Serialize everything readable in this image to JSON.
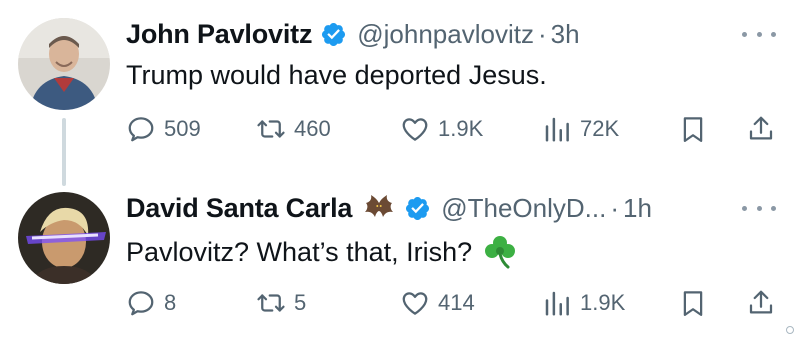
{
  "tweets": [
    {
      "name": "John Pavlovitz",
      "handle": "@johnpavlovitz",
      "separator": "·",
      "time": "3h",
      "text": "Trump would have deported Jesus.",
      "replies": "509",
      "reposts": "460",
      "likes": "1.9K",
      "views": "72K"
    },
    {
      "name": "David Santa Carla",
      "name_emoji": "bat-emoji",
      "handle": "@TheOnlyD...",
      "separator": "·",
      "time": "1h",
      "text": "Pavlovitz? What’s that, Irish?",
      "text_emoji": "shamrock-emoji",
      "replies": "8",
      "reposts": "5",
      "likes": "414",
      "views": "1.9K"
    }
  ],
  "colors": {
    "text": "#0f1419",
    "muted": "#536471",
    "verified": "#1d9bf0",
    "thread_line": "#cfd9de",
    "shamrock": "#3cb043"
  },
  "icons": [
    "reply-icon",
    "repost-icon",
    "like-icon",
    "views-icon",
    "bookmark-icon",
    "share-icon",
    "more-icon",
    "verified-icon"
  ]
}
